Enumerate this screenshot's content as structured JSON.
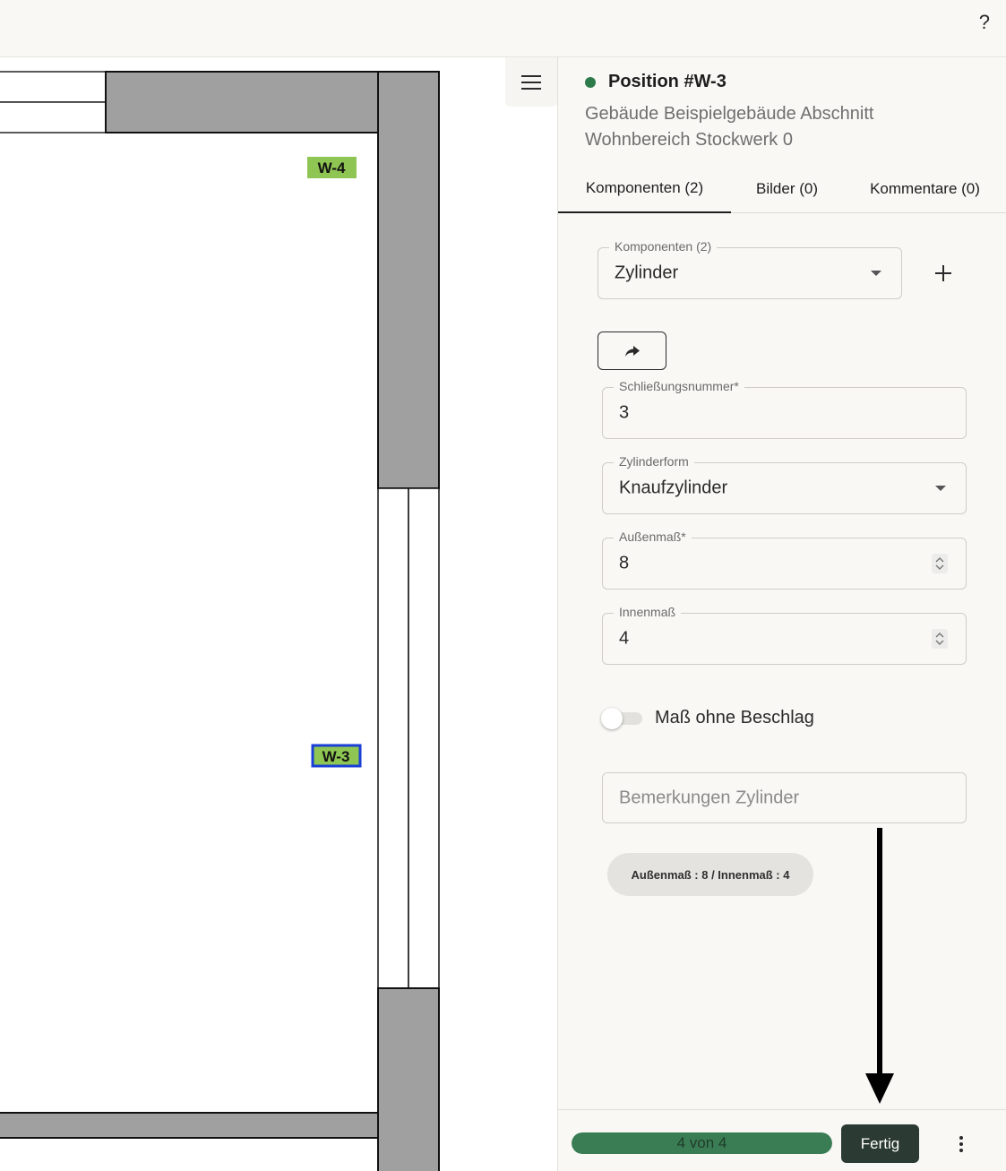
{
  "app": {
    "help_label": "?"
  },
  "floorplan": {
    "markers": [
      {
        "label": "W-4",
        "selected": false
      },
      {
        "label": "W-3",
        "selected": true
      }
    ],
    "colors": {
      "marker": "#8fc552",
      "selected_border": "#1a3fd6",
      "wall": "#a0a0a0"
    }
  },
  "panel": {
    "position_title": "Position #W-3",
    "location_line1": "Gebäude Beispielgebäude Abschnitt",
    "location_line2": "Wohnbereich Stockwerk 0",
    "status_color": "#2d7a4b",
    "tabs": [
      {
        "label": "Komponenten (2)",
        "active": true
      },
      {
        "label": "Bilder (0)",
        "active": false
      },
      {
        "label": "Kommentare (0)",
        "active": false
      }
    ],
    "component_select": {
      "legend": "Komponenten (2)",
      "value": "Zylinder"
    },
    "fields": {
      "schliessung": {
        "legend": "Schließungsnummer*",
        "value": "3"
      },
      "zylinderform": {
        "legend": "Zylinderform",
        "value": "Knaufzylinder"
      },
      "aussenmass": {
        "legend": "Außenmaß*",
        "value": "8"
      },
      "innenmass": {
        "legend": "Innenmaß",
        "value": "4"
      }
    },
    "toggle": {
      "label": "Maß ohne Beschlag",
      "checked": false
    },
    "remarks": {
      "placeholder": "Bemerkungen Zylinder"
    },
    "summary_chip": "Außenmaß : 8 / Innenmaß : 4",
    "footer": {
      "progress_text": "4 von 4",
      "progress_fraction": 1.0,
      "done_label": "Fertig"
    }
  }
}
